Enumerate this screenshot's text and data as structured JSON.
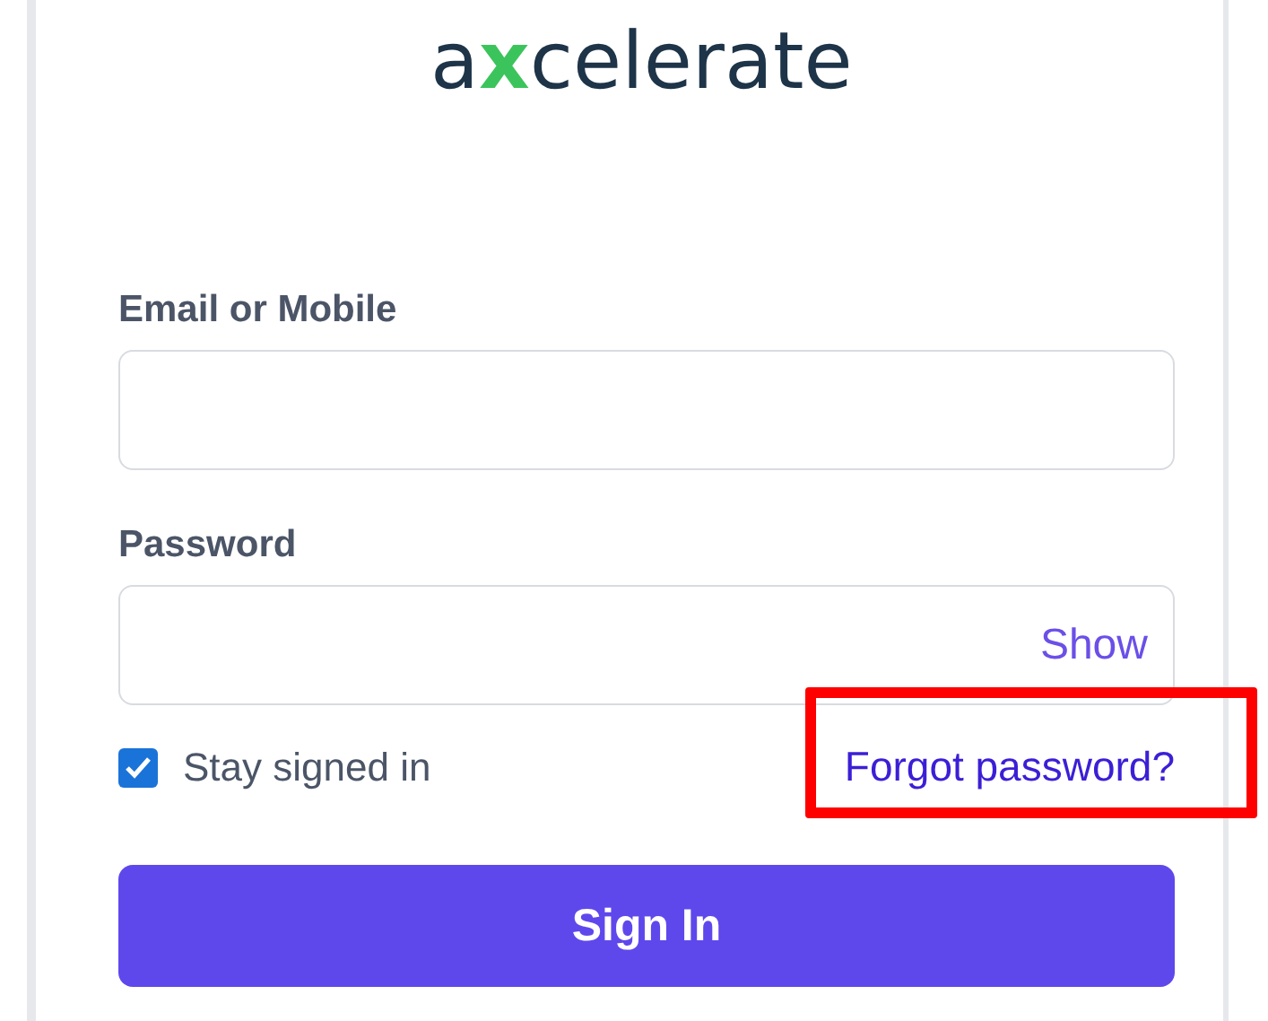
{
  "logo": {
    "parts": [
      {
        "text": "a",
        "accent": false
      },
      {
        "text": "x",
        "accent": true
      },
      {
        "text": "celerate",
        "accent": false
      }
    ]
  },
  "email": {
    "label": "Email or Mobile"
  },
  "password": {
    "label": "Password",
    "toggle": "Show"
  },
  "stay_signed_in": {
    "label": "Stay signed in",
    "checked": true
  },
  "forgot_password": {
    "text": "Forgot password?",
    "highlighted": true
  },
  "submit": {
    "label": "Sign In"
  }
}
